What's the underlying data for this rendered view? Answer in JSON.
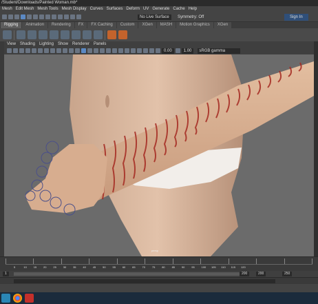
{
  "window": {
    "title": "/Student/Downloads/Painted Woman.mb*"
  },
  "menus": [
    "Mesh",
    "Edit Mesh",
    "Mesh Tools",
    "Mesh Display",
    "Curves",
    "Surfaces",
    "Deform",
    "UV",
    "Generate",
    "Cache",
    "Help"
  ],
  "status_line": {
    "live_surface": "No Live Surface",
    "symmetry": "Symmetry: Off",
    "sign_in": "Sign In"
  },
  "shelf_tabs": [
    {
      "label": "Rigging",
      "active": true
    },
    {
      "label": "Animation",
      "active": false
    },
    {
      "label": "Rendering",
      "active": false
    },
    {
      "label": "FX",
      "active": false
    },
    {
      "label": "FX Caching",
      "active": false
    },
    {
      "label": "Custom",
      "active": false
    },
    {
      "label": "XGen",
      "active": false
    },
    {
      "label": "MASH",
      "active": false
    },
    {
      "label": "Motion Graphics",
      "active": false
    },
    {
      "label": "XGen",
      "active": false
    }
  ],
  "shelf_icons": [
    "joint-tool-icon",
    "ik-handle-icon",
    "bind-skin-icon",
    "paint-weights-icon",
    "blendshape-icon",
    "cluster-icon",
    "lattice-icon",
    "nonlinear-icon"
  ],
  "viewport_menus": [
    "View",
    "Shading",
    "Lighting",
    "Show",
    "Renderer",
    "Panels"
  ],
  "viewport_toolbar": {
    "field_1": "0.00",
    "field_2": "1.00",
    "color_space": "sRGB gamma"
  },
  "camera_label": "persp",
  "time_slider": {
    "ticks": [
      "5",
      "10",
      "15",
      "20",
      "25",
      "30",
      "35",
      "40",
      "45",
      "50",
      "55",
      "60",
      "65",
      "70",
      "75",
      "80",
      "85",
      "90",
      "95",
      "100",
      "105",
      "110",
      "115",
      "120"
    ]
  },
  "range_slider": {
    "start": "1",
    "end_left": "200",
    "end_right": "200",
    "far_right": "250",
    "far_right_2": "250"
  },
  "colors": {
    "panel": "#444444",
    "viewport_bg": "#6b6b6b",
    "skin": "#d8b094",
    "paint": "#a52a22",
    "accent_orange": "#c3632c",
    "taskbar": "#1b2b3c"
  }
}
